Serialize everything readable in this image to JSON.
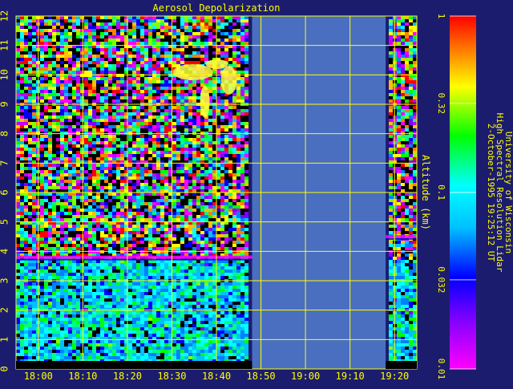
{
  "chart_data": {
    "type": "heatmap",
    "title": "Aerosol Depolarization",
    "ylabel": "Altitude (km)",
    "xlabel": "",
    "x_ticks": [
      "18:00",
      "18:10",
      "18:20",
      "18:30",
      "18:40",
      "18:50",
      "19:00",
      "19:10",
      "19:20"
    ],
    "x_range": [
      "17:55",
      "19:25"
    ],
    "y_ticks": [
      "0",
      "1",
      "2",
      "3",
      "4",
      "5",
      "6",
      "7",
      "8",
      "9",
      "10",
      "11",
      "12"
    ],
    "y_range": [
      0,
      12
    ],
    "grid": true,
    "colorbar": {
      "scale": "log",
      "range": [
        0.01,
        1
      ],
      "tick_labels": [
        "1",
        "0.32",
        "0.1",
        "0.032",
        "0.01"
      ],
      "tick_values": [
        1,
        0.32,
        0.1,
        0.032,
        0.01
      ],
      "colors": [
        "#ff0000",
        "#ff8000",
        "#ffff00",
        "#00ff00",
        "#00ffff",
        "#0000ff",
        "#8000ff",
        "#ff00ff"
      ]
    },
    "data_gap": {
      "start": "18:48",
      "end": "19:18"
    },
    "features": [
      {
        "label": "aerosol layer top",
        "altitude_km": 3.8,
        "time_range": [
          "17:55",
          "18:48"
        ]
      },
      {
        "label": "cirrus cloud",
        "altitude_km": [
          8.5,
          10.5
        ],
        "time_range": [
          "18:28",
          "18:45"
        ]
      },
      {
        "label": "layer",
        "altitude_km": 4.5,
        "time_range": [
          "19:18",
          "19:25"
        ]
      }
    ]
  },
  "credits": {
    "line1": "University of Wisconsin",
    "line2": "High Spectral Resolution Lidar",
    "line3": "2-October-1995 19:25:12 UT"
  },
  "colors": {
    "background": "#1c1c6e",
    "grid": "#ffff00",
    "gap_fill": "#4a6fc0",
    "text": "#ffff00"
  }
}
